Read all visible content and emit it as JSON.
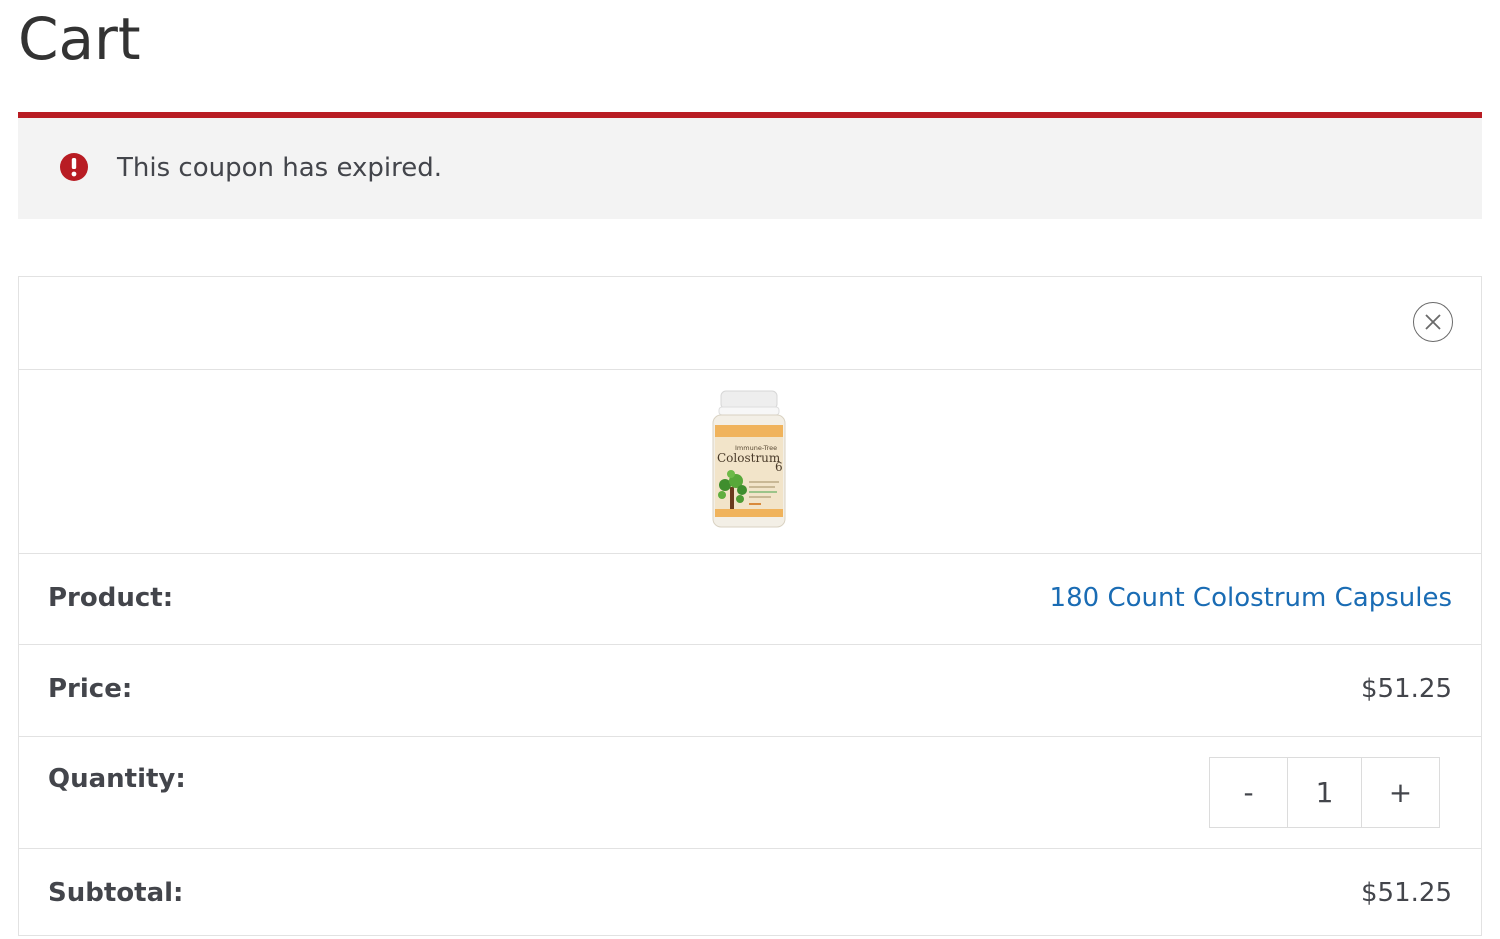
{
  "page": {
    "title": "Cart"
  },
  "notice": {
    "icon": "exclamation-circle-icon",
    "message": "This coupon has expired.",
    "accent_color": "#b81c23"
  },
  "cart_item": {
    "remove_icon": "close-icon",
    "thumbnail_brand_text": "Immune-Tree",
    "thumbnail_product_text": "Colostrum",
    "thumbnail_number": "6",
    "product_label": "Product:",
    "product_name": "180 Count Colostrum Capsules",
    "price_label": "Price:",
    "price": "$51.25",
    "quantity_label": "Quantity:",
    "quantity_decrement": "-",
    "quantity_value": "1",
    "quantity_increment": "+",
    "subtotal_label": "Subtotal:",
    "subtotal": "$51.25",
    "link_color": "#1a6cb4"
  }
}
